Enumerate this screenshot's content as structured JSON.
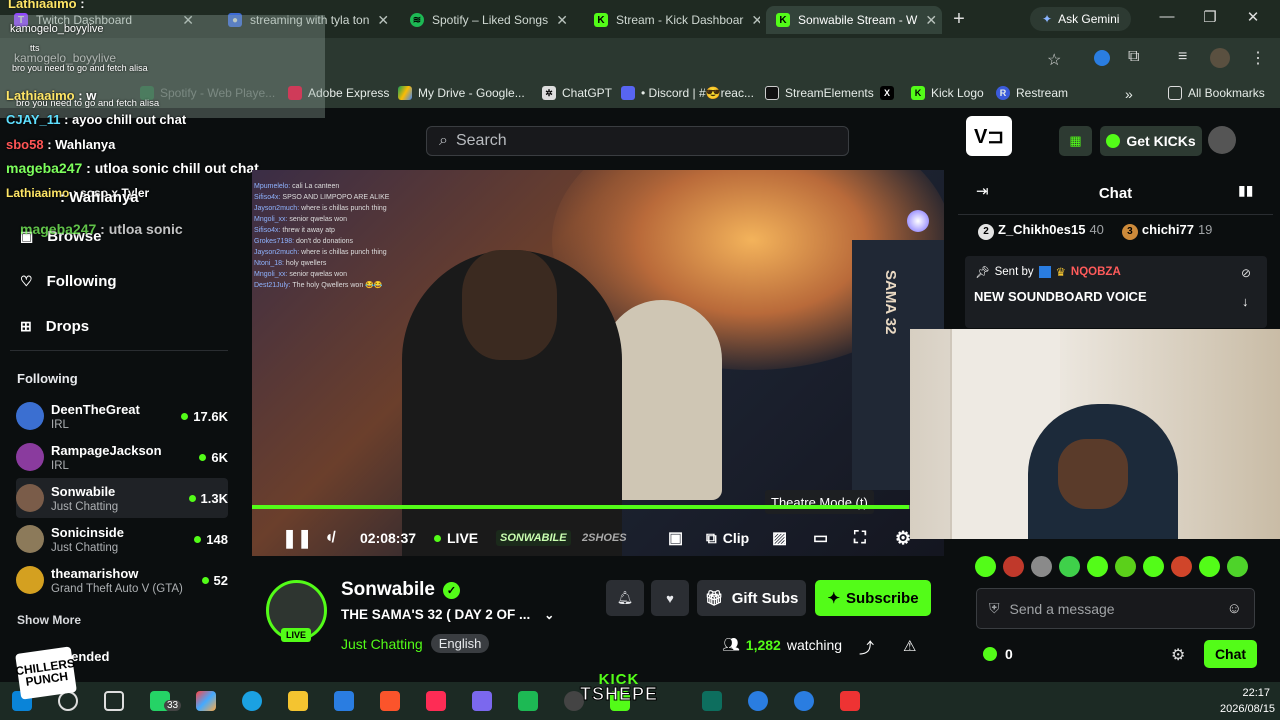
{
  "browser": {
    "tabs": [
      {
        "label": "Twitch Dashboard",
        "active": false
      },
      {
        "label": "streaming with tyla ton",
        "active": false
      },
      {
        "label": "Spotify – Liked Songs",
        "active": false
      },
      {
        "label": "Stream - Kick Dashboar",
        "active": false
      },
      {
        "label": "Sonwabile Stream - W",
        "active": true
      }
    ],
    "gemini_label": "Ask Gemini",
    "bookmarks": [
      "Spotify - Web Playe...",
      "Adobe Express",
      "My Drive - Google...",
      "ChatGPT",
      "• Discord | #😎reac...",
      "StreamElements",
      "Kick Logo",
      "Restream"
    ],
    "all_bookmarks": "All Bookmarks"
  },
  "header": {
    "search_placeholder": "Search",
    "logo_text": "V⊐",
    "get_kicks": "Get KICKs"
  },
  "sidebar": {
    "nav": [
      {
        "label": "Browse"
      },
      {
        "label": "Following"
      },
      {
        "label": "Drops"
      }
    ],
    "following_heading": "Following",
    "channels": [
      {
        "name": "DeenTheGreat",
        "category": "IRL",
        "viewers": "17.6K",
        "color": "#3b6fd1"
      },
      {
        "name": "RampageJackson",
        "category": "IRL",
        "viewers": "6K",
        "color": "#8a3b9e"
      },
      {
        "name": "Sonwabile",
        "category": "Just Chatting",
        "viewers": "1.3K",
        "color": "#7a5c49"
      },
      {
        "name": "Sonicinside",
        "category": "Just Chatting",
        "viewers": "148",
        "color": "#8c7a5a"
      },
      {
        "name": "theamarishow",
        "category": "Grand Theft Auto V (GTA)",
        "viewers": "52",
        "color": "#d4a020"
      }
    ],
    "show_more": "Show More",
    "recommended": "mmended"
  },
  "overlay_chat": [
    {
      "user": "Lathiaaimo",
      "text": ":",
      "user_color": "#ffe666"
    },
    {
      "user": "kamogelo_boyylive",
      "text": "",
      "user_color": "#ffffff"
    },
    {
      "user": "",
      "text": "tts",
      "user_color": "#ffffff"
    },
    {
      "user": "kamogelo_boyylive",
      "text": "",
      "user_color": "#ffffff"
    },
    {
      "user": "",
      "text": "bro you need to go and fetch alisa",
      "user_color": "#ffffff"
    },
    {
      "user": "Lathiaaimo",
      "text": ": w",
      "user_color": "#ffe666"
    },
    {
      "user": "",
      "text": "bro you need to go and fetch alisa",
      "user_color": "#ffffff"
    },
    {
      "user": "CJAY_11",
      "text": ": ayoo chill out chat",
      "user_color": "#5fe0ff"
    },
    {
      "user": "sbo58",
      "text": ": Wahlanya",
      "user_color": "#ff5555"
    },
    {
      "user": "mageba247",
      "text": ": utloa sonic chill out chat",
      "user_color": "#7dff5d"
    },
    {
      "user": "Lathiaaimo",
      "text": ": soso x Tyler",
      "user_color": "#ffe666"
    },
    {
      "user": "sbo58",
      "text": ": Wahlanya",
      "user_color": "#ff5555"
    },
    {
      "user": "mageba247",
      "text": ": utloa sonic",
      "user_color": "#7dff5d"
    }
  ],
  "video": {
    "chat_lines": [
      {
        "user": "Mpumelelo:",
        "text": "cali La canteen"
      },
      {
        "user": "Sifiso4x:",
        "text": "SPSO AND LIMPOPO ARE ALIKE"
      },
      {
        "user": "Jayson2much:",
        "text": "where is chillas punch thing"
      },
      {
        "user": "Mngoli_xx:",
        "text": "senior qwelas won"
      },
      {
        "user": "Sifiso4x:",
        "text": "threw it away atp"
      },
      {
        "user": "Grokes7198:",
        "text": "don't do donations"
      },
      {
        "user": "Jayson2much:",
        "text": "where is chillas punch thing"
      },
      {
        "user": "Ntoni_18:",
        "text": "holy qwellers"
      },
      {
        "user": "Mngoli_xx:",
        "text": "senior qwelas won"
      },
      {
        "user": "Dest21July:",
        "text": "The holy Qwellers won 😂😂"
      }
    ],
    "stage_text": "SAMA 32",
    "time": "02:08:37",
    "live_label": "LIVE",
    "sponsor1": "SONWABILE",
    "sponsor2": "2SHOES",
    "clip_label": "Clip",
    "tooltip": "Theatre Mode (t)",
    "progress": 0.95
  },
  "stream": {
    "streamer": "Sonwabile",
    "live_badge": "LIVE",
    "title": "THE SAMA'S 32 ( DAY 2 OF ...",
    "category": "Just Chatting",
    "language": "English",
    "gift_subs": "Gift Subs",
    "subscribe": "Subscribe",
    "watching_count": "1,282",
    "watching_label": "watching"
  },
  "chat": {
    "title": "Chat",
    "gifters": [
      {
        "rank": "2",
        "name": "Z_Chikh0es15",
        "count": "40"
      },
      {
        "rank": "3",
        "name": "chichi77",
        "count": "19"
      }
    ],
    "pinned_by_label": "Sent by",
    "pinned_by_user": "NQOBZA",
    "pinned_message": "NEW SOUNDBOARD VOICE",
    "input_placeholder": "Send a message",
    "kicks_count": "0",
    "chat_button": "Chat"
  },
  "taskbar": {
    "time": "22:17",
    "date": "2026/08/15",
    "whatsapp_badge": "33",
    "kick_overlay_top": "KICK",
    "kick_overlay_bottom": "TSHEPE",
    "sticker": "CHILLERS PUNCH"
  }
}
